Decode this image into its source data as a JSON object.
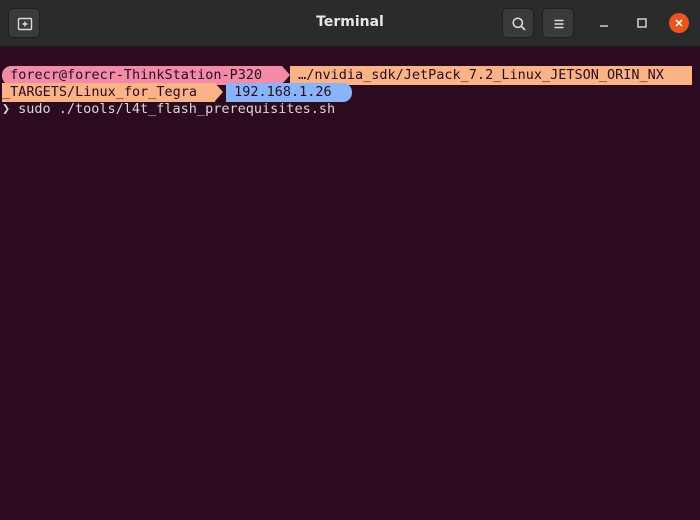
{
  "window": {
    "title": "Terminal"
  },
  "icons": {
    "new_tab": "new-tab-icon",
    "search": "search-icon",
    "menu": "hamburger-menu-icon",
    "minimize": "minimize-icon",
    "maximize": "maximize-icon",
    "close": "close-icon"
  },
  "prompt": {
    "user_host": " forecr@forecr-ThinkStation-P320 ",
    "path_line1": " …/nvidia_sdk/JetPack_7.2_Linux_JETSON_ORIN_NX",
    "path_line2": "_TARGETS/Linux_for_Tegra ",
    "ip": " 192.168.1.26 ",
    "symbol": "❯",
    "command": " sudo ./tools/l4t_flash_prerequisites.sh"
  },
  "colors": {
    "terminal_bg": "#2c0a1f",
    "user_segment": "#f38ba8",
    "path_segment": "#fab387",
    "ip_segment": "#89b4fa",
    "close_button": "#e95420"
  }
}
